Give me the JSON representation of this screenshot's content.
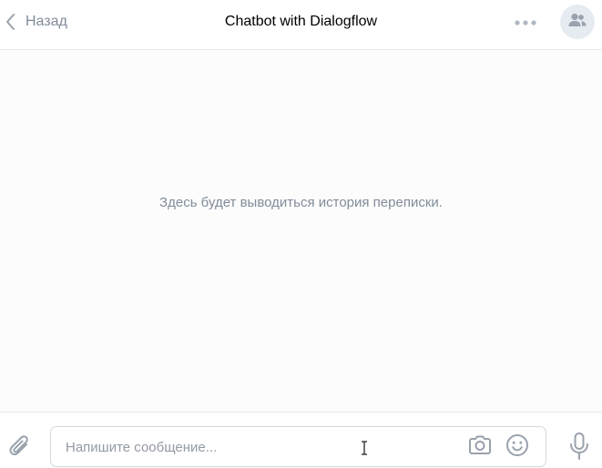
{
  "header": {
    "back_label": "Назад",
    "title": "Chatbot with Dialogflow",
    "back_icon": "chevron-left-icon",
    "more_icon": "more-horizontal-icon",
    "avatar_icon": "users-icon"
  },
  "history": {
    "empty_text": "Здесь будет выводиться история переписки."
  },
  "composer": {
    "placeholder": "Напишите сообщение...",
    "value": "",
    "attach_icon": "paperclip-icon",
    "camera_icon": "camera-icon",
    "emoji_icon": "smile-icon",
    "mic_icon": "microphone-icon"
  },
  "colors": {
    "icon": "#99a2ad",
    "muted_text": "#818c99",
    "border": "#e7e8ec",
    "avatar_bg": "#e6ebf2"
  }
}
